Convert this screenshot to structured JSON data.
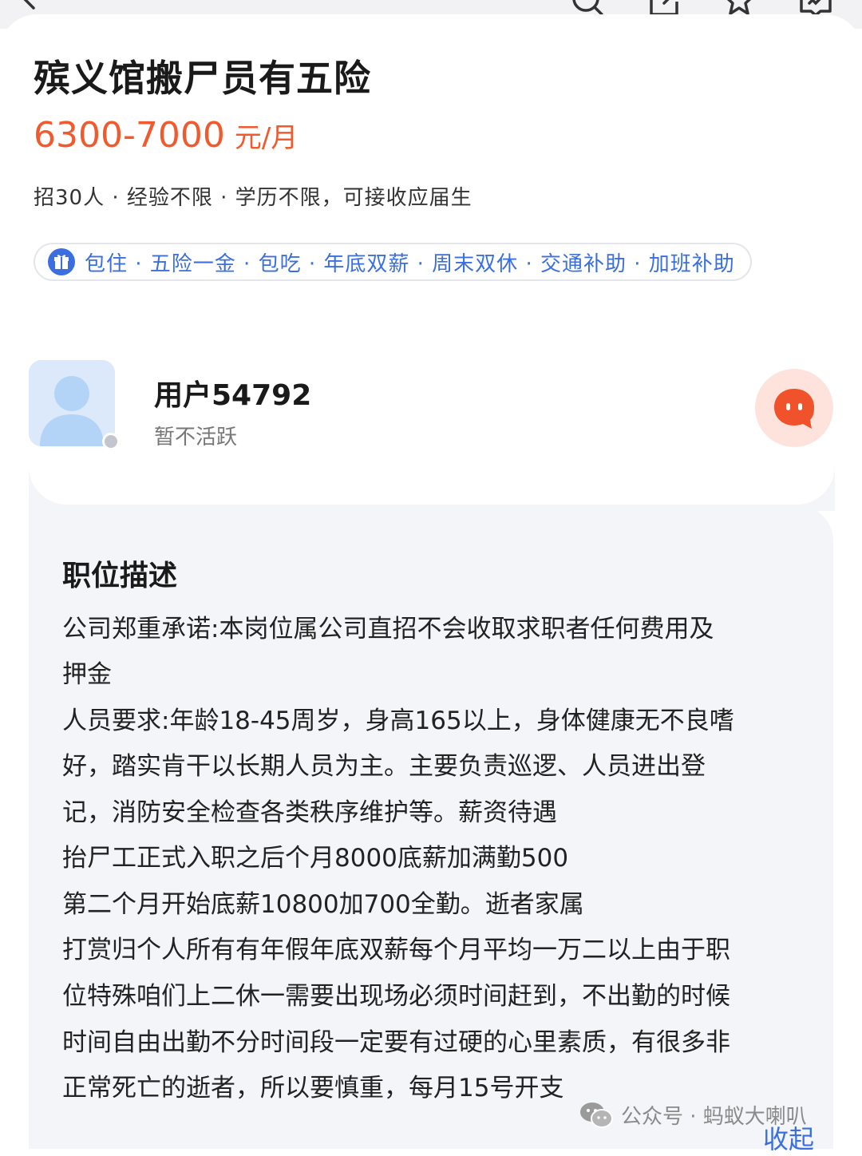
{
  "header": {
    "icons": [
      "back-icon",
      "search-icon",
      "share-icon",
      "star-icon",
      "report-icon"
    ]
  },
  "job": {
    "title": "殡义馆搬尸员有五险",
    "salary_range": "6300-7000",
    "salary_unit": "元/月",
    "meta": "招30人 · 经验不限 · 学历不限，可接收应届生",
    "benefits_icon": "gift-icon",
    "benefits": "包住 · 五险一金 · 包吃 · 年底双薪 · 周末双休 · 交通补助 · 加班补助"
  },
  "recruiter": {
    "name": "用户54792",
    "status": "暂不活跃",
    "avatar_icon": "default-avatar-icon",
    "chat_icon": "chat-bubble-icon"
  },
  "description": {
    "heading": "职位描述",
    "lines": [
      "公司郑重承诺:本岗位属公司直招不会收取求职者任何费用及",
      "押金",
      "人员要求:年龄18-45周岁，身高165以上，身体健康无不良嗜",
      "好，踏实肯干以长期人员为主。主要负责巡逻、人员进出登",
      "记，消防安全检查各类秩序维护等。薪资待遇",
      "抬尸工正式入职之后个月8000底薪加满勤500",
      "第二个月开始底薪10800加700全勤。逝者家属",
      "打赏归个人所有有年假年底双薪每个月平均一万二以上由于职",
      "位特殊咱们上二休一需要出现场必须时间赶到，不出勤的时候",
      "时间自由出勤不分时间段一定要有过硬的心里素质，有很多非",
      "正常死亡的逝者，所以要慎重，每月15号开支"
    ],
    "collapse_label": "收起"
  },
  "watermark": {
    "icon": "wechat-icon",
    "text": "公众号 · 蚂蚁大喇叭"
  },
  "colors": {
    "salary": "#f05a2e",
    "benefits": "#3b6fe0",
    "section_bg": "#f4f5f8",
    "chat_bg": "#fde3dc",
    "chat_icon": "#f0532b"
  }
}
